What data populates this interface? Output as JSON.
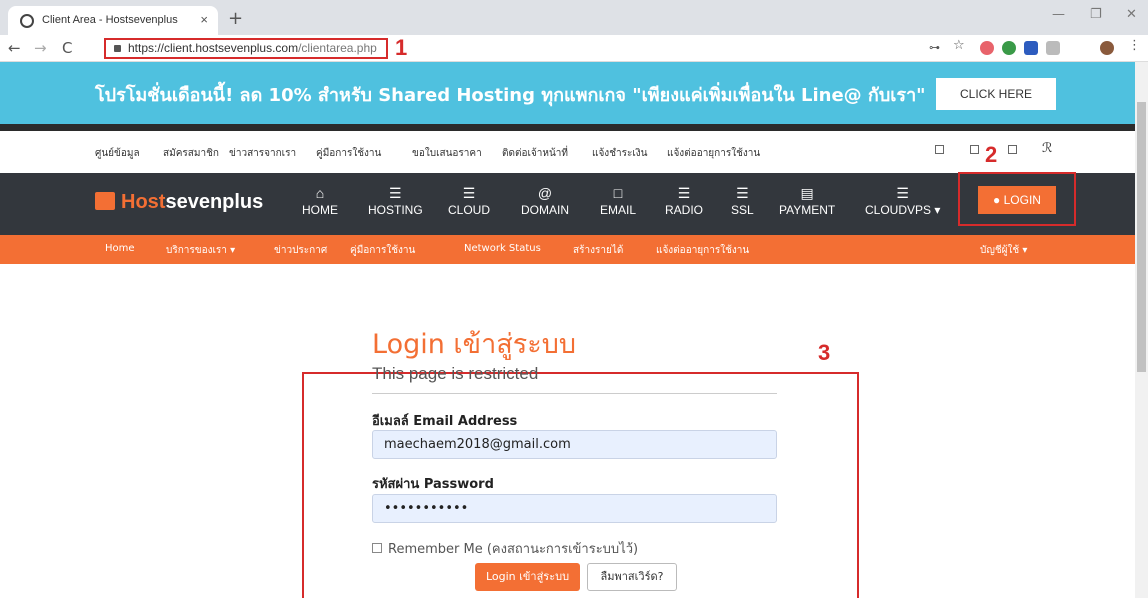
{
  "browser": {
    "tab_title": "Client Area - Hostsevenplus",
    "tab_close": "×",
    "new_tab": "+",
    "url_host": "https://client.hostsevenplus.com",
    "url_path": "/clientarea.php",
    "window_minimize": "—",
    "window_restore": "❐",
    "window_close": "✕",
    "back": "←",
    "forward": "→",
    "reload": "C"
  },
  "annotations": {
    "a1": "1",
    "a2": "2",
    "a3": "3"
  },
  "promo": {
    "text": "โปรโมชั่นเดือนนี้! ลด 10% สำหรับ Shared Hosting ทุกแพกเกจ \"เพียงแค่เพิ่มเพื่อนใน Line@ กับเรา\"",
    "button": "CLICK HERE"
  },
  "topnav": [
    "ศูนย์ข้อมูล",
    "สมัครสมาชิก",
    "ข่าวสารจากเรา",
    "คู่มือการใช้งาน",
    "ขอใบเสนอราคา",
    "ติดต่อเจ้าหน้าที่",
    "แจ้งชำระเงิน",
    "แจ้งต่ออายุการใช้งาน"
  ],
  "logo": {
    "part1": "Host",
    "part2": "sevenplus"
  },
  "mainnav": [
    {
      "label": "HOME",
      "icon": "⌂"
    },
    {
      "label": "HOSTING",
      "icon": "☰"
    },
    {
      "label": "CLOUD",
      "icon": "☰"
    },
    {
      "label": "DOMAIN",
      "icon": "@"
    },
    {
      "label": "EMAIL",
      "icon": "□"
    },
    {
      "label": "RADIO",
      "icon": "☰"
    },
    {
      "label": "SSL",
      "icon": "☰"
    },
    {
      "label": "PAYMENT",
      "icon": "▤"
    },
    {
      "label": "CLOUDVPS ▾",
      "icon": "☰"
    }
  ],
  "login_button": "LOGIN",
  "subnav": [
    "Home",
    "บริการของเรา ▾",
    "ข่าวประกาศ",
    "คู่มือการใช้งาน",
    "Network Status",
    "สร้างรายได้",
    "แจ้งต่ออายุการใช้งาน",
    "บัญชีผู้ใช้ ▾"
  ],
  "login_form": {
    "title": "Login เข้าสู่ระบบ",
    "subtitle": "This page is restricted",
    "email_label": "อีเมลล์ Email Address",
    "email_value": "maechaem2018@gmail.com",
    "password_label": "รหัสผ่าน Password",
    "password_value": "•••••••••••",
    "remember_label": "Remember Me (คงสถานะการเข้าระบบไว้)",
    "submit": "Login เข้าสู่ระบบ",
    "forgot": "ลืมพาสเวิร์ด?"
  },
  "colors": {
    "accent": "#f36f34",
    "promo_bg": "#4fc1df",
    "nav_bg": "#33373d",
    "annotation": "#d62b2b"
  }
}
